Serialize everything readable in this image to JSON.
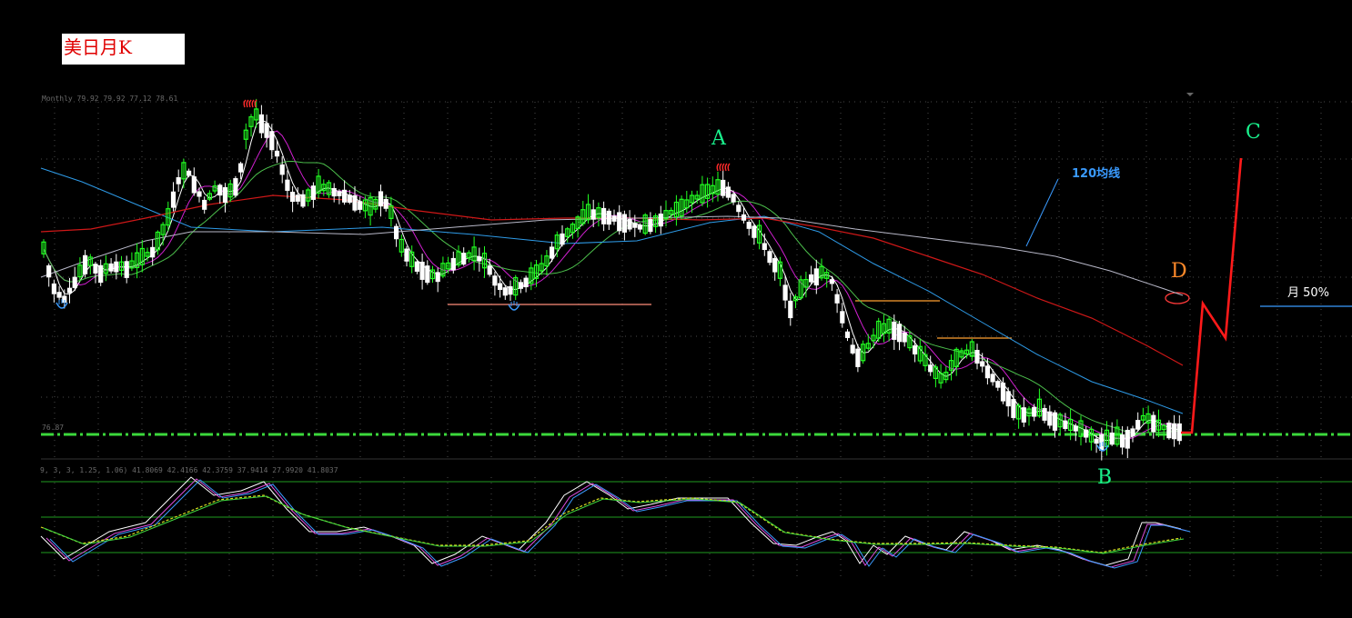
{
  "title": "美日月K",
  "chart_data": {
    "type": "candlestick",
    "title": "美日月K",
    "instrument_header": "Monthly 79.92 79.92 77.12 78.61",
    "oscillator_header": "9, 3, 3, 1.25, 1.06) 41.8069 42.4166 42.3759 37.9414 27.9920 41.8037",
    "price_marker": "76.87",
    "annotations": {
      "A": "A",
      "B": "B",
      "C": "C",
      "D": "D",
      "ma120": "120均线",
      "month50": "月 50%"
    },
    "colors": {
      "bull": "#22ff22",
      "bear": "#ffffff",
      "ma_white": "#ffffff",
      "ma_magenta": "#d020d0",
      "ma_green": "#4cbf4c",
      "ma_blue": "#2e9be8",
      "ma_red": "#d01818",
      "ma_gray": "#b8b8c8",
      "projection": "#ff1a1a",
      "support_line": "#3bd83b"
    }
  }
}
